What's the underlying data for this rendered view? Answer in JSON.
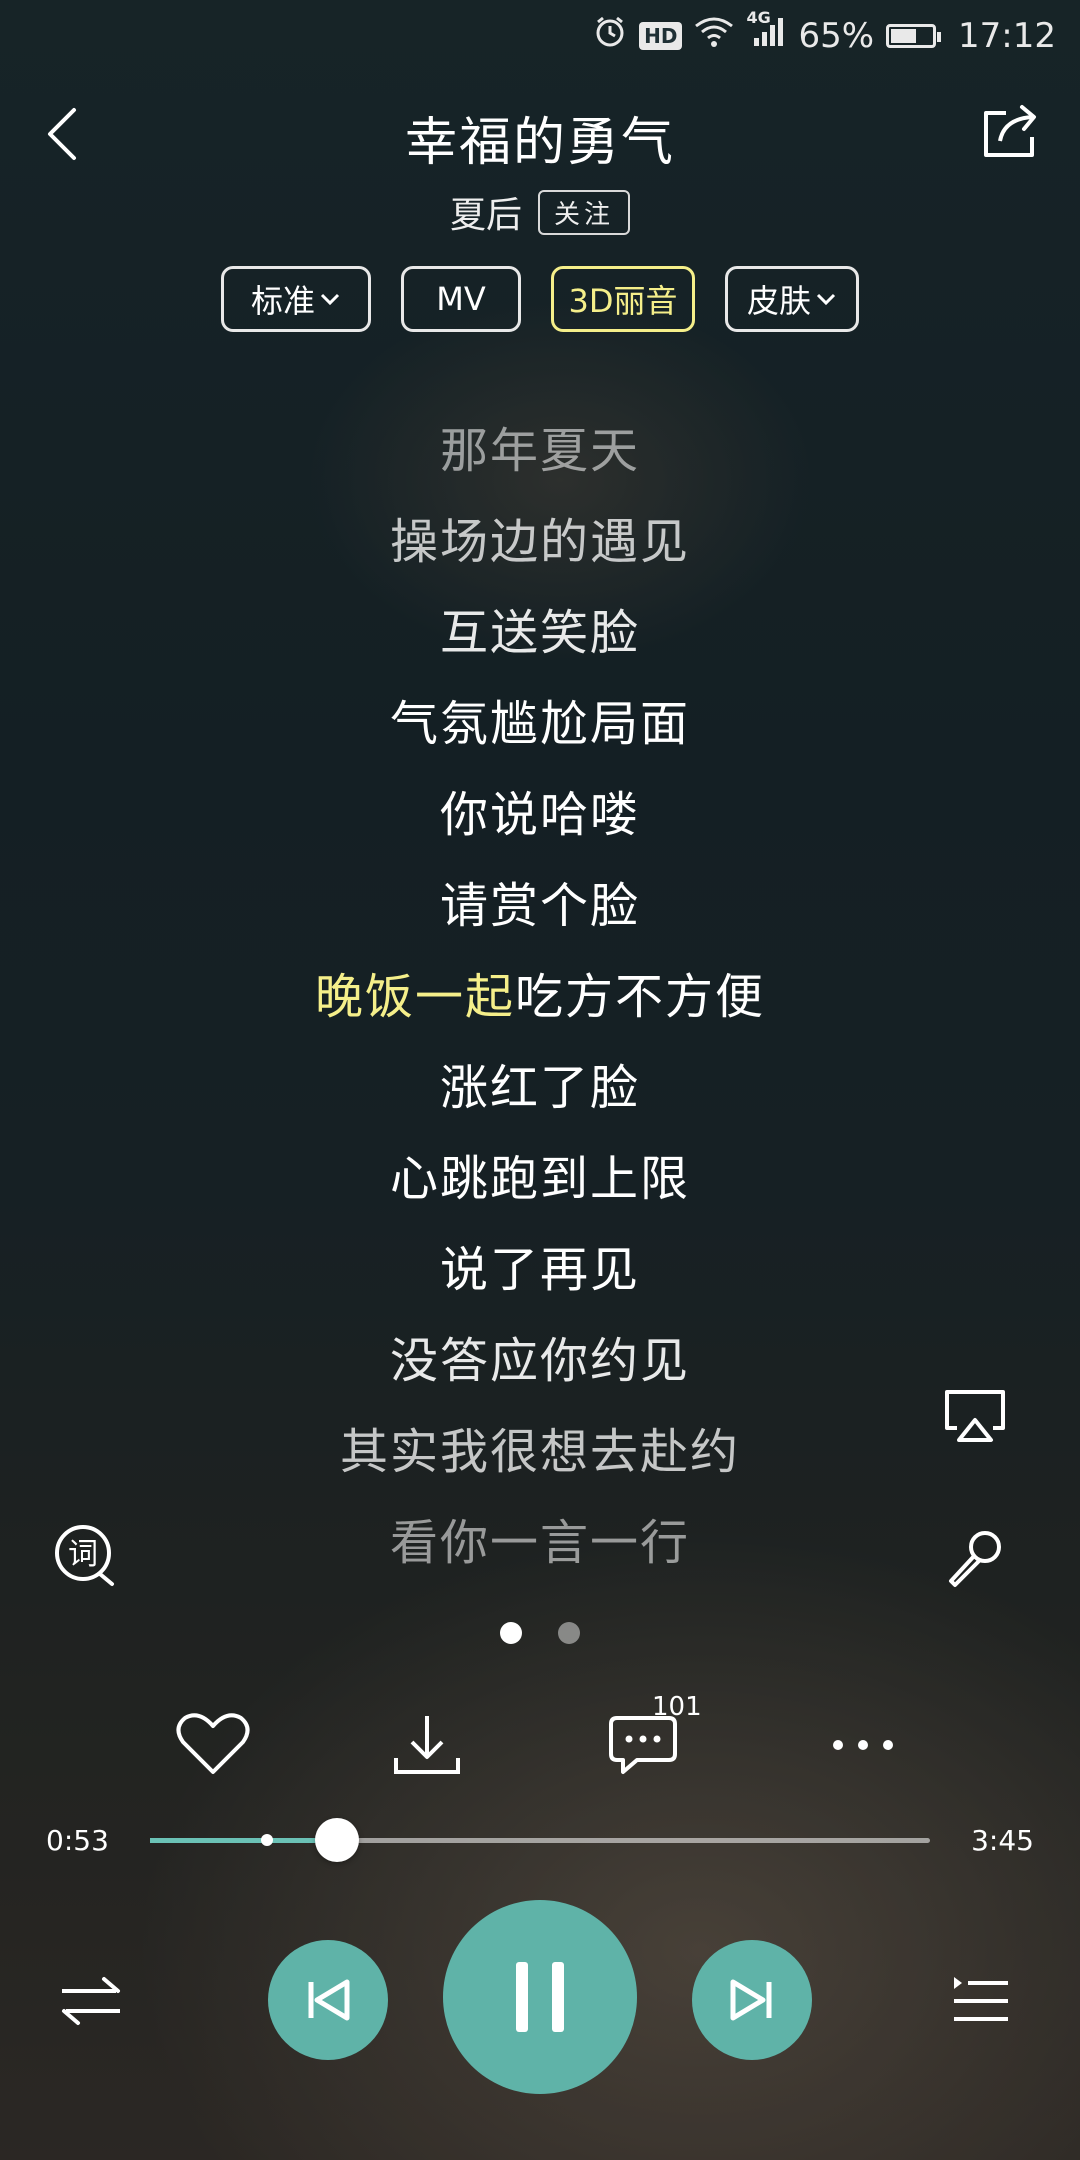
{
  "status_bar": {
    "network": "4G",
    "hd_label": "HD",
    "battery": "65%",
    "battery_level": 0.65,
    "time": "17:12"
  },
  "header": {
    "title": "幸福的勇气",
    "artist": "夏后",
    "follow_label": "关注"
  },
  "options": [
    {
      "label": "标准",
      "dropdown": true
    },
    {
      "label": "MV",
      "dropdown": false
    },
    {
      "label": "3D丽音",
      "dropdown": false
    },
    {
      "label": "皮肤",
      "dropdown": true
    }
  ],
  "lyrics": {
    "lines": [
      "那年夏天",
      "操场边的遇见",
      "互送笑脸",
      "气氛尴尬局面",
      "你说哈喽",
      "请赏个脸",
      "晚饭一起吃方不方便",
      "涨红了脸",
      "心跳跑到上限",
      "说了再见",
      "没答应你约见",
      "其实我很想去赴约",
      "看你一言一行"
    ],
    "current_index": 6,
    "current_sung": "晚饭一起",
    "current_unsung": "吃方不方便"
  },
  "actions": {
    "comment_count": "101"
  },
  "progress": {
    "current": "0:53",
    "total": "3:45",
    "played_fraction": 0.24,
    "buffered_fraction": 0.15
  },
  "colors": {
    "accent": "#5fb3a8",
    "lyric_highlight": "#f5ef8a",
    "progress_played": "#6bc2b6"
  },
  "icons": [
    "back-icon",
    "share-icon",
    "cast-icon",
    "microphone-icon",
    "lyric-mode-icon",
    "heart-icon",
    "download-icon",
    "comment-icon",
    "more-icon",
    "shuffle-icon",
    "previous-icon",
    "pause-icon",
    "next-icon",
    "playlist-icon"
  ]
}
